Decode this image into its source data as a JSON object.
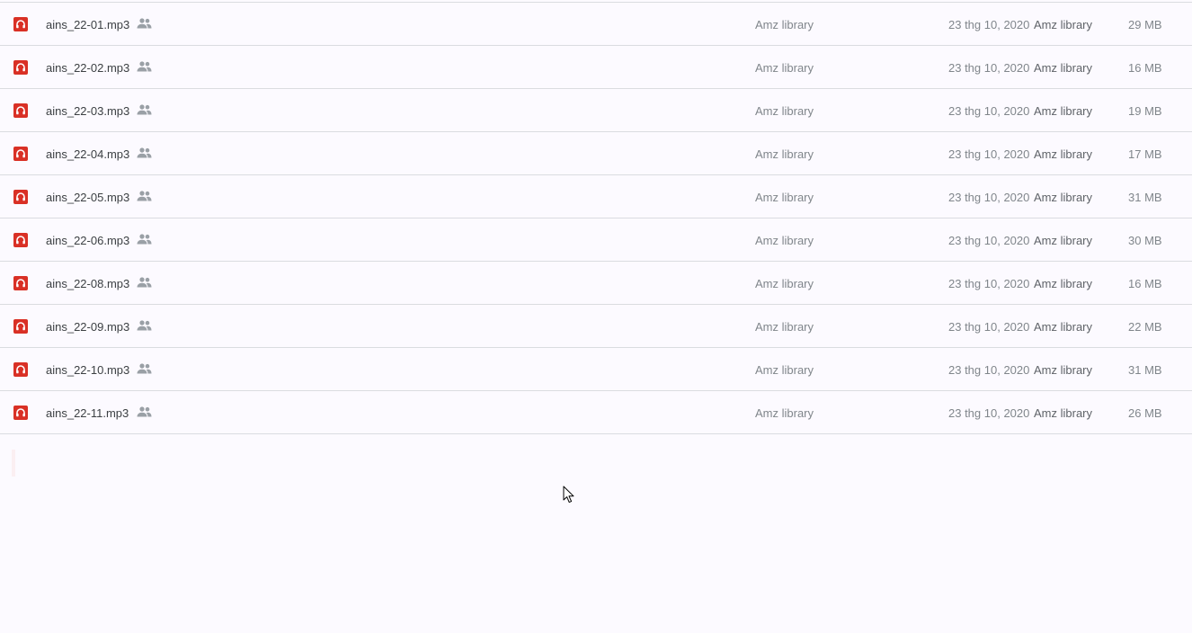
{
  "files": [
    {
      "name": "ains_22-01.mp3",
      "owner": "Amz library",
      "modified": "23 thg 10, 2020",
      "modifier": "Amz library",
      "size": "29 MB"
    },
    {
      "name": "ains_22-02.mp3",
      "owner": "Amz library",
      "modified": "23 thg 10, 2020",
      "modifier": "Amz library",
      "size": "16 MB"
    },
    {
      "name": "ains_22-03.mp3",
      "owner": "Amz library",
      "modified": "23 thg 10, 2020",
      "modifier": "Amz library",
      "size": "19 MB"
    },
    {
      "name": "ains_22-04.mp3",
      "owner": "Amz library",
      "modified": "23 thg 10, 2020",
      "modifier": "Amz library",
      "size": "17 MB"
    },
    {
      "name": "ains_22-05.mp3",
      "owner": "Amz library",
      "modified": "23 thg 10, 2020",
      "modifier": "Amz library",
      "size": "31 MB"
    },
    {
      "name": "ains_22-06.mp3",
      "owner": "Amz library",
      "modified": "23 thg 10, 2020",
      "modifier": "Amz library",
      "size": "30 MB"
    },
    {
      "name": "ains_22-08.mp3",
      "owner": "Amz library",
      "modified": "23 thg 10, 2020",
      "modifier": "Amz library",
      "size": "16 MB"
    },
    {
      "name": "ains_22-09.mp3",
      "owner": "Amz library",
      "modified": "23 thg 10, 2020",
      "modifier": "Amz library",
      "size": "22 MB"
    },
    {
      "name": "ains_22-10.mp3",
      "owner": "Amz library",
      "modified": "23 thg 10, 2020",
      "modifier": "Amz library",
      "size": "31 MB"
    },
    {
      "name": "ains_22-11.mp3",
      "owner": "Amz library",
      "modified": "23 thg 10, 2020",
      "modifier": "Amz library",
      "size": "26 MB"
    }
  ],
  "icons": {
    "file_type": "audio-file-icon",
    "shared": "shared-people-icon",
    "cursor": "mouse-cursor-icon"
  },
  "colors": {
    "audio_icon": "#d93025",
    "shared_icon": "#9aa0a6",
    "divider": "#dadce0",
    "background": "#fcfaff"
  }
}
